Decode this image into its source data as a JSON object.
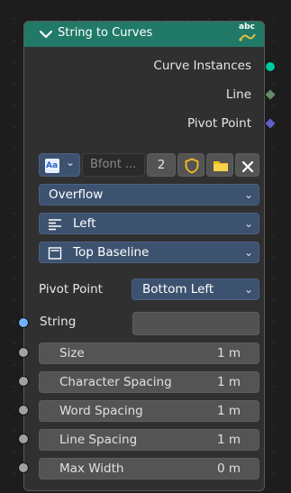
{
  "node": {
    "title": "String to Curves",
    "header_color": "#217a67",
    "header_icon": "abc-text-icon"
  },
  "outputs": [
    {
      "label": "Curve Instances",
      "socket_color": "#00c8a0",
      "socket_shape": "circle"
    },
    {
      "label": "Line",
      "socket_color": "#6a8a6a",
      "socket_shape": "diamond"
    },
    {
      "label": "Pivot Point",
      "socket_color": "#6060c8",
      "socket_shape": "diamond"
    }
  ],
  "font": {
    "icon": "font-file-icon",
    "name": "Bfont ...",
    "users": "2",
    "fake_user_icon": "shield-icon",
    "open_icon": "folder-icon",
    "unlink_icon": "close-icon"
  },
  "overflow": {
    "value": "Overflow"
  },
  "align_x": {
    "value": "Left",
    "icon": "align-left-icon"
  },
  "align_y": {
    "value": "Top Baseline",
    "icon": "top-baseline-icon"
  },
  "pivot_point": {
    "label": "Pivot Point",
    "value": "Bottom Left"
  },
  "inputs": {
    "string": {
      "label": "String",
      "value": "",
      "socket_color": "#70b2ff"
    },
    "fields": [
      {
        "label": "Size",
        "value": "1 m"
      },
      {
        "label": "Character Spacing",
        "value": "1 m"
      },
      {
        "label": "Word Spacing",
        "value": "1 m"
      },
      {
        "label": "Line Spacing",
        "value": "1 m"
      },
      {
        "label": "Max Width",
        "value": "0 m"
      }
    ],
    "field_socket_color": "#a1a1a1"
  }
}
